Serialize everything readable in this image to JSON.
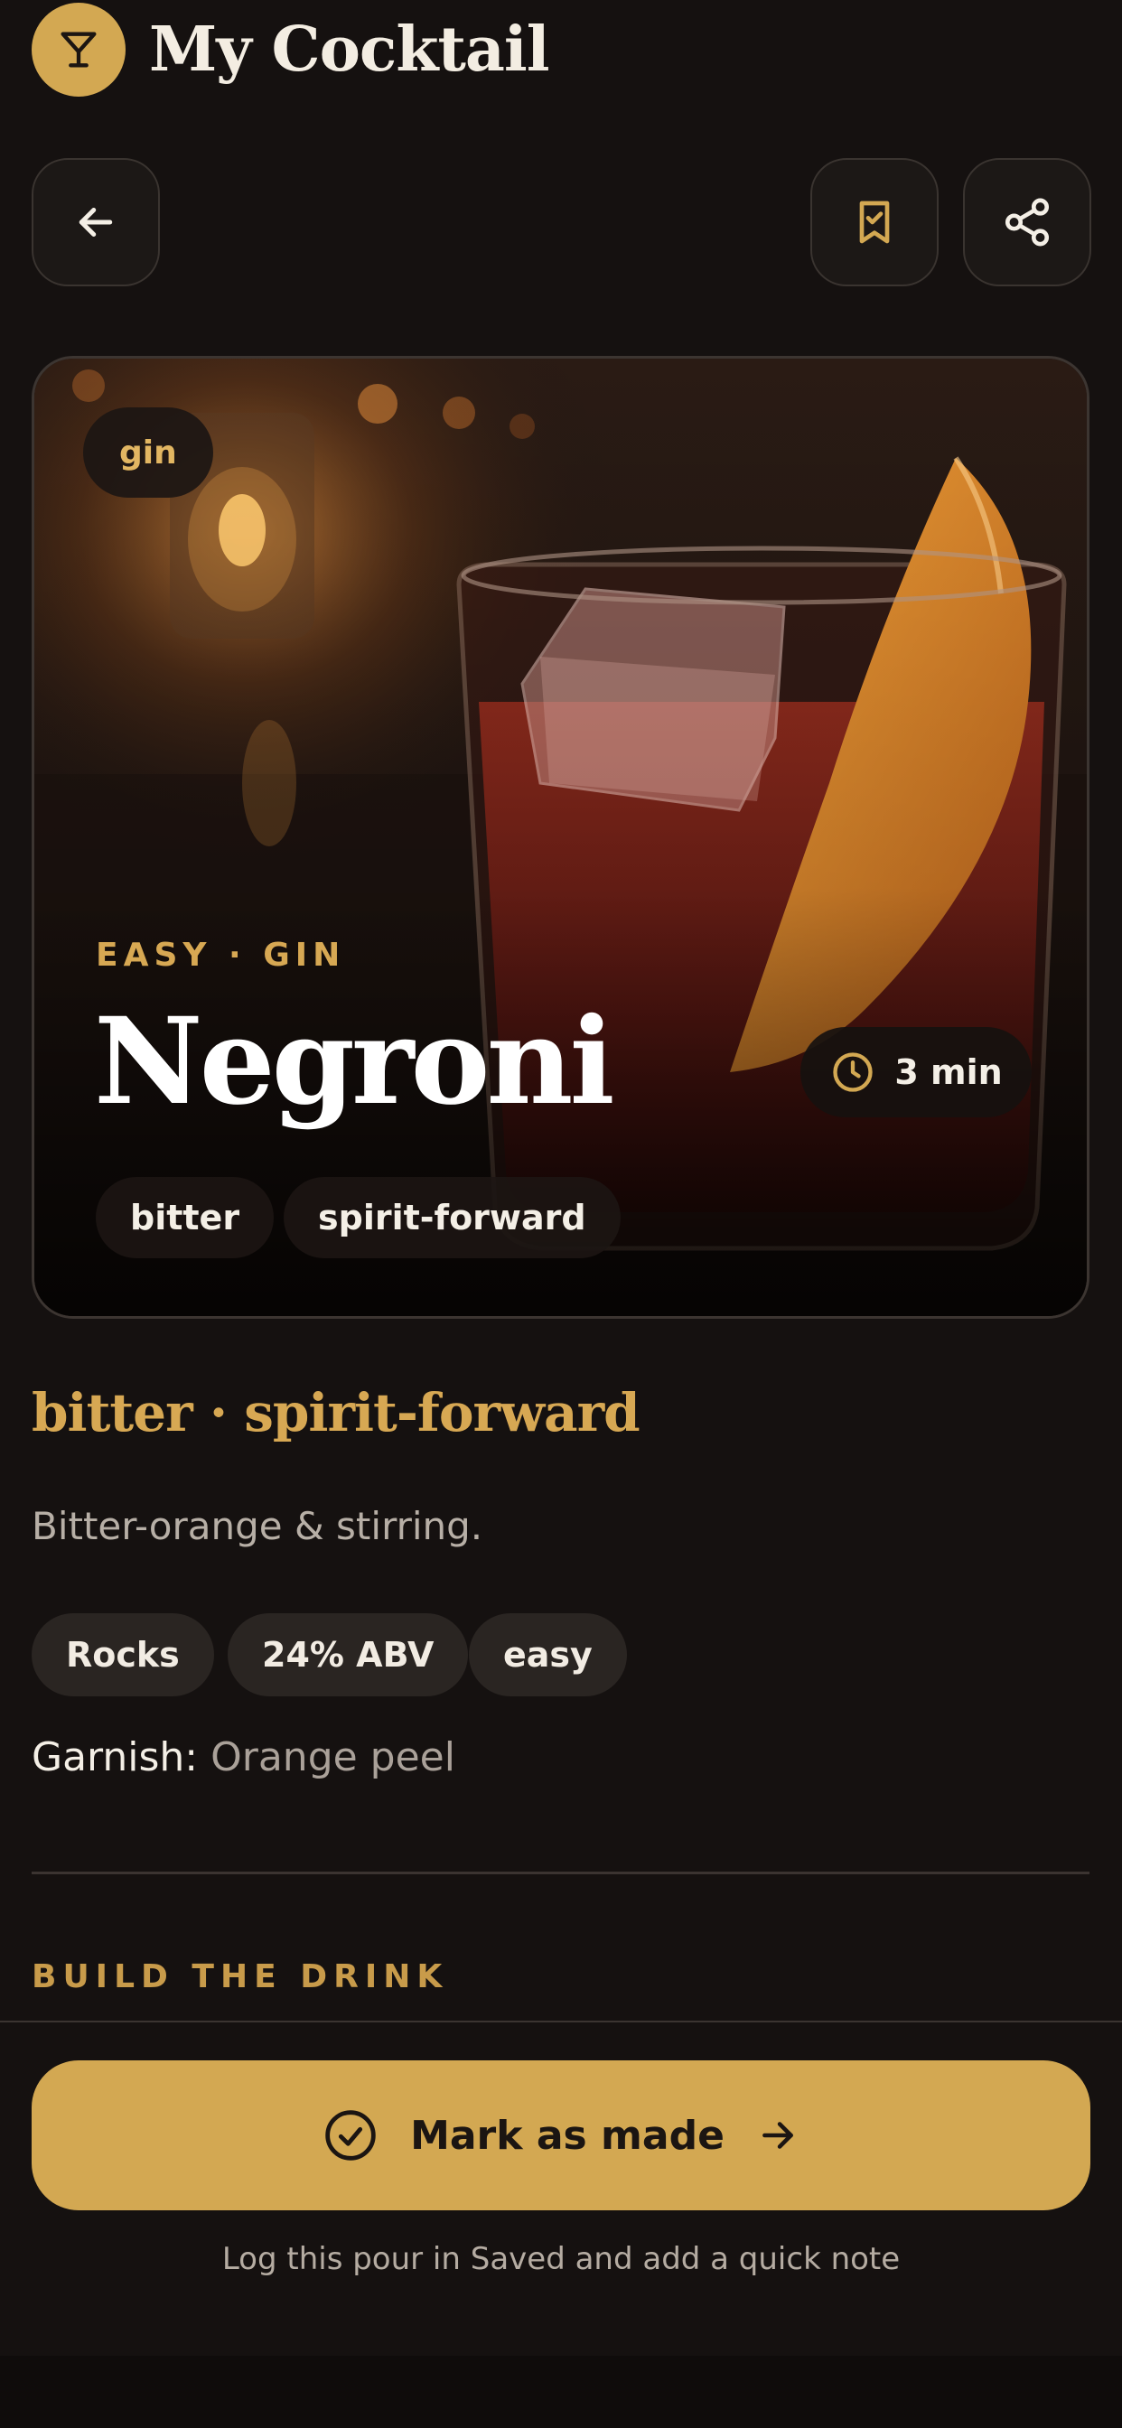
{
  "app": {
    "title": "My Cocktail",
    "logo_icon": "cocktail-glass-icon",
    "accent_color": "#d3a852"
  },
  "toolbar": {
    "back_icon": "arrow-left-icon",
    "save_icon": "bookmark-check-icon",
    "share_icon": "share-icon"
  },
  "hero": {
    "spirit_chip": "gin",
    "overline": "EASY · GIN",
    "name": "Negroni",
    "time": "3 min",
    "time_icon": "clock-icon",
    "tags": [
      "bitter",
      "spirit-forward"
    ]
  },
  "details": {
    "flavor_line": "bitter · spirit-forward",
    "description": "Bitter-orange & stirring.",
    "pills": [
      "Rocks",
      "24% ABV",
      "easy"
    ],
    "garnish_label": "Garnish:",
    "garnish_value": "Orange peel"
  },
  "section": {
    "title": "BUILD THE DRINK"
  },
  "footer": {
    "cta_label": "Mark as made",
    "cta_lead_icon": "check-circle-icon",
    "cta_trail_icon": "arrow-right-icon",
    "hint": "Log this pour in Saved and add a quick note"
  }
}
